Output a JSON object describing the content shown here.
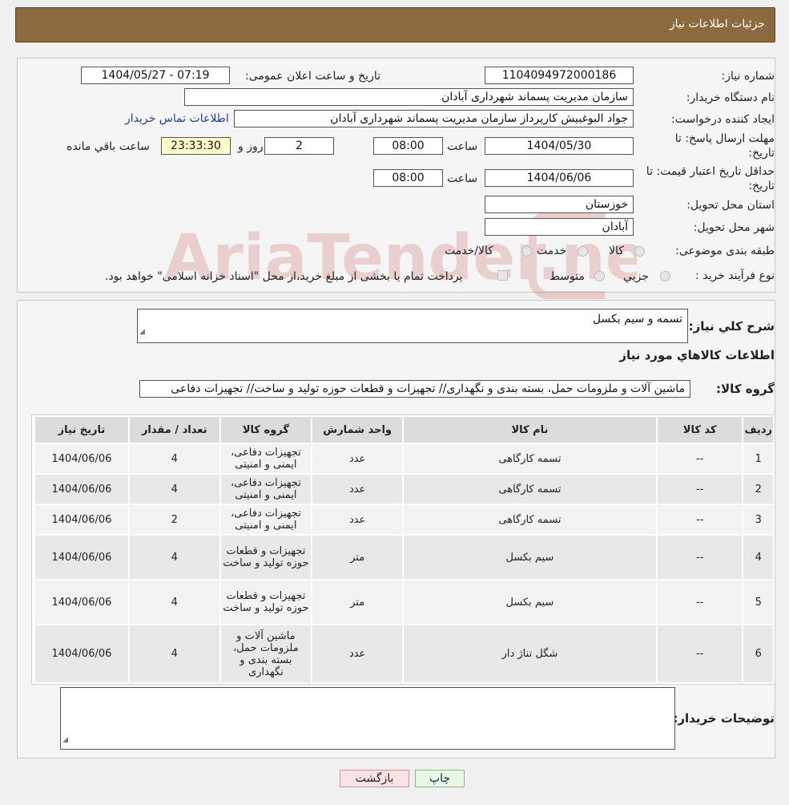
{
  "header": {
    "title": "جزئیات اطلاعات نیاز"
  },
  "form": {
    "need_number_label": "شماره نیاز:",
    "need_number": "1104094972000186",
    "announce_label": "تاریخ و ساعت اعلان عمومی:",
    "announce_value": "1404/05/27 - 07:19",
    "buyer_org_label": "نام دستگاه خریدار:",
    "buyer_org": "سازمان مدیریت پسماند شهرداری آبادان",
    "creator_label": "ایجاد کننده درخواست:",
    "creator": "جواد البوغبیش کارپرداز سازمان مدیریت پسماند شهرداری آبادان",
    "contact_link": "اطلاعات تماس خریدار",
    "deadline_label_1": "مهلت ارسال پاسخ: تا",
    "deadline_label_2": "تاریخ:",
    "deadline_date": "1404/05/30",
    "time_label": "ساعت",
    "deadline_time": "08:00",
    "days": "2",
    "days_label": "روز و",
    "remaining_time": "23:33:30",
    "remaining_label": "ساعت باقي مانده",
    "validity_label_1": "حداقل تاریخ اعتبار قیمت: تا",
    "validity_label_2": "تاریخ:",
    "validity_date": "1404/06/06",
    "validity_time_label": "ساعت",
    "validity_time": "08:00",
    "province_label": "استان محل تحویل:",
    "province": "خوزستان",
    "city_label": "شهر محل تحویل:",
    "city": "آبادان",
    "category_label": "طبقه بندی موضوعی:",
    "category_options": [
      "کالا",
      "خدمت",
      "کالا/خدمت"
    ],
    "purchase_type_label": "نوع فرآیند خرید :",
    "purchase_options": [
      "جزیي",
      "متوسط"
    ],
    "purchase_note": "پرداخت تمام یا بخشی از مبلغ خرید،از محل \"اسناد خزانه اسلامی\" خواهد بود."
  },
  "details": {
    "summary_label": "شرح کلي نیاز:",
    "summary": "تسمه و سیم بکسل",
    "goods_info_title": "اطلاعات کالاهاي مورد نیاز",
    "goods_group_label": "گروه کالا:",
    "goods_group": "ماشین آلات و ملزومات حمل، بسته بندی و نگهداری// تجهیزات و قطعات حوزه تولید و ساخت// تجهیزات دفاعی"
  },
  "table": {
    "headers": [
      "ردیف",
      "کد کالا",
      "نام کالا",
      "واحد شمارش",
      "گروه کالا",
      "تعداد / مقدار",
      "تاریخ نیاز"
    ],
    "rows": [
      [
        "1",
        "--",
        "تسمه کارگاهی",
        "عدد",
        "تجهیزات دفاعی، ایمنی و امنیتی",
        "4",
        "1404/06/06"
      ],
      [
        "2",
        "--",
        "تسمه کارگاهی",
        "عدد",
        "تجهیزات دفاعی، ایمنی و امنیتی",
        "4",
        "1404/06/06"
      ],
      [
        "3",
        "--",
        "تسمه کارگاهی",
        "عدد",
        "تجهیزات دفاعی، ایمنی و امنیتی",
        "2",
        "1404/06/06"
      ],
      [
        "4",
        "--",
        "سیم بکسل",
        "متر",
        "تجهیزات و قطعات حوزه تولید و ساخت",
        "4",
        "1404/06/06"
      ],
      [
        "5",
        "--",
        "سیم بکسل",
        "متر",
        "تجهیزات و قطعات حوزه تولید و ساخت",
        "4",
        "1404/06/06"
      ],
      [
        "6",
        "--",
        "شگل تناژ دار",
        "عدد",
        "ماشین آلات و ملزومات حمل، بسته بندی و نگهداری",
        "4",
        "1404/06/06"
      ]
    ]
  },
  "buyer_notes": {
    "label": "توضیحات خریدار:",
    "value": ""
  },
  "buttons": {
    "print": "چاپ",
    "back": "بازگشت"
  },
  "watermark": {
    "text": "AriaTender.neT",
    "color": "#c0504d"
  }
}
